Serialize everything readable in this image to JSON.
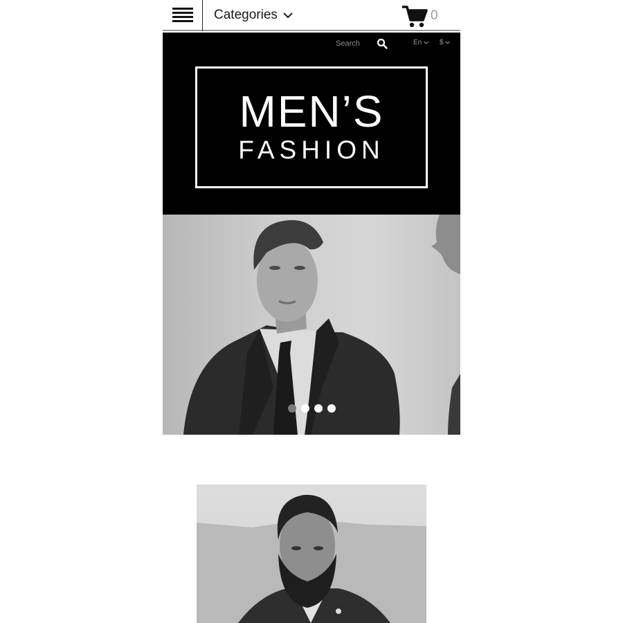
{
  "header": {
    "categories_label": "Categories",
    "cart_count": "0"
  },
  "hero": {
    "search_placeholder": "Search",
    "language": "En",
    "currency": "$",
    "logo_line1": "MEN’S",
    "logo_line2": "FASHION"
  },
  "slider": {
    "slide_count": 4,
    "active_index": 0
  },
  "colors": {
    "background": "#ffffff",
    "hero_bg": "#000000",
    "muted_text": "#9a9a9a"
  }
}
